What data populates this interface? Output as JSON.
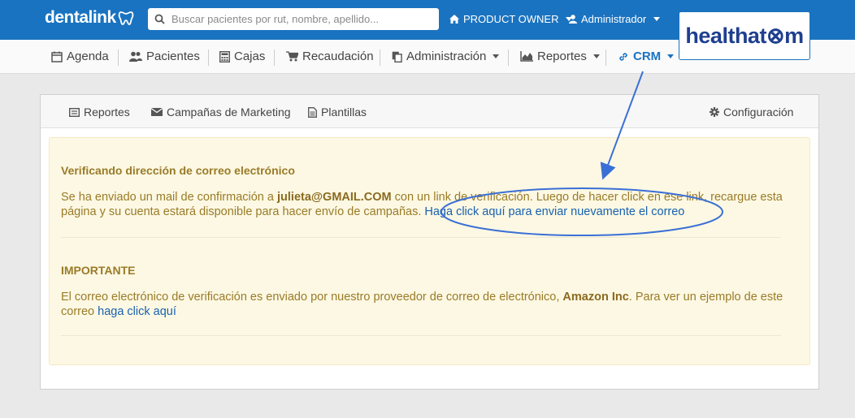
{
  "brand": {
    "logo_text": "dentalink"
  },
  "search": {
    "placeholder": "Buscar pacientes por rut, nombre, apellido..."
  },
  "topbar": {
    "role_label": "PRODUCT OWNER",
    "user_label": "Administrador"
  },
  "badge": {
    "text": "healthat⊗m"
  },
  "nav": {
    "items": [
      {
        "label": "Agenda"
      },
      {
        "label": "Pacientes"
      },
      {
        "label": "Cajas"
      },
      {
        "label": "Recaudación"
      },
      {
        "label": "Administración"
      },
      {
        "label": "Reportes"
      },
      {
        "label": "CRM"
      }
    ]
  },
  "subnav": {
    "reportes": "Reportes",
    "campanas": "Campañas de Marketing",
    "plantillas": "Plantillas",
    "configuracion": "Configuración"
  },
  "alert": {
    "heading1": "Verificando dirección de correo electrónico",
    "p1_a": "Se ha enviado un mail de confirmación a ",
    "p1_email": "julieta@GMAIL.COM",
    "p1_b": " con un link de verificación. Luego de hacer click en ese link, recargue esta página y su cuenta estará disponible para hacer envío de campañas. ",
    "p1_link": "Haga click aquí para enviar nuevamente el correo",
    "heading2": "IMPORTANTE",
    "p2_a": "El correo electrónico de verificación es enviado por nuestro proveedor de correo de electrónico, ",
    "p2_company": "Amazon Inc",
    "p2_b": ". Para ver un ejemplo de este correo ",
    "p2_link": "haga click aquí"
  },
  "colors": {
    "primary": "#1a73c0",
    "alert_bg": "#fcf8e3",
    "alert_text": "#9a7b28",
    "link": "#1861b0"
  }
}
